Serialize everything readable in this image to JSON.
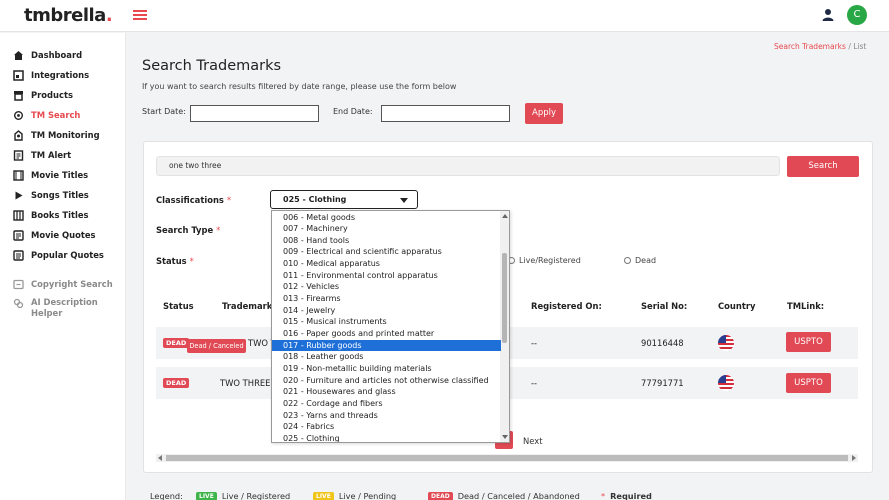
{
  "app": {
    "logo_text": "tmbrella",
    "logo_dot": ".",
    "user_initial": "C"
  },
  "colors": {
    "accent": "#e84a4f",
    "button": "#e14a55",
    "avatar": "#27a745",
    "selected": "#1e6fd8",
    "live": "#3fb549",
    "pending": "#f0c419"
  },
  "sidebar": {
    "items": [
      {
        "label": "Dashboard",
        "icon": "home-icon"
      },
      {
        "label": "Integrations",
        "icon": "integrations-icon"
      },
      {
        "label": "Products",
        "icon": "products-icon"
      },
      {
        "label": "TM Search",
        "icon": "search-icon"
      },
      {
        "label": "TM Monitoring",
        "icon": "monitoring-icon"
      },
      {
        "label": "TM Alert",
        "icon": "alert-icon"
      },
      {
        "label": "Movie Titles",
        "icon": "film-icon"
      },
      {
        "label": "Songs Titles",
        "icon": "play-icon"
      },
      {
        "label": "Books Titles",
        "icon": "book-icon"
      },
      {
        "label": "Movie Quotes",
        "icon": "quote-icon"
      },
      {
        "label": "Popular Quotes",
        "icon": "popular-quote-icon"
      },
      {
        "label": "Copyright Search",
        "icon": "copyright-icon"
      },
      {
        "label": "AI Description Helper",
        "icon": "ai-icon"
      }
    ]
  },
  "breadcrumb": {
    "link": "Search Trademarks",
    "sep": "/",
    "current": "List"
  },
  "header": {
    "title": "Search Trademarks",
    "subtitle": "If you want to search results filtered by date range, please use the form below"
  },
  "dates": {
    "start_label": "Start Date:",
    "end_label": "End Date:",
    "apply_label": "Apply"
  },
  "search": {
    "query": "one two three",
    "button_label": "Search"
  },
  "form": {
    "classifications_label": "Classifications",
    "search_type_label": "Search Type",
    "status_label": "Status",
    "required_mark": "*",
    "selected_class": "025 - Clothing",
    "status_options": [
      "Live/Registered",
      "Dead"
    ]
  },
  "dropdown": {
    "options": [
      "006 - Metal goods",
      "007 - Machinery",
      "008 - Hand tools",
      "009 - Electrical and scientific apparatus",
      "010 - Medical apparatus",
      "011 - Environmental control apparatus",
      "012 - Vehicles",
      "013 - Firearms",
      "014 - Jewelry",
      "015 - Musical instruments",
      "016 - Paper goods and printed matter",
      "017 - Rubber goods",
      "018 - Leather goods",
      "019 - Non-metallic building materials",
      "020 - Furniture and articles not otherwise classified",
      "021 - Housewares and glass",
      "022 - Cordage and fibers",
      "023 - Yarns and threads",
      "024 - Fabrics",
      "025 - Clothing"
    ],
    "highlighted_index": 11
  },
  "table": {
    "headers": {
      "status": "Status",
      "trademark": "Trademark",
      "registered": "Registered On:",
      "serial": "Serial No:",
      "country": "Country",
      "tmlink": "TMLink:"
    },
    "rows": [
      {
        "status": "DEAD",
        "trademark": "TWO T",
        "registered": "--",
        "serial": "90116448",
        "country": "us-flag-icon",
        "link": "USPTO"
      },
      {
        "status": "DEAD",
        "trademark": "TWO THREE",
        "registered": "--",
        "serial": "77791771",
        "country": "us-flag-icon",
        "link": "USPTO"
      }
    ],
    "tooltip": "Dead / Canceled"
  },
  "pagination": {
    "next_label": "Next"
  },
  "legend": {
    "title": "Legend:",
    "items": [
      {
        "tag": "LIVE",
        "text": "Live / Registered"
      },
      {
        "tag": "LIVE",
        "text": "Live / Pending"
      },
      {
        "tag": "DEAD",
        "text": "Dead / Canceled / Abandoned"
      }
    ],
    "required_mark": "*",
    "required_text": "Required"
  }
}
